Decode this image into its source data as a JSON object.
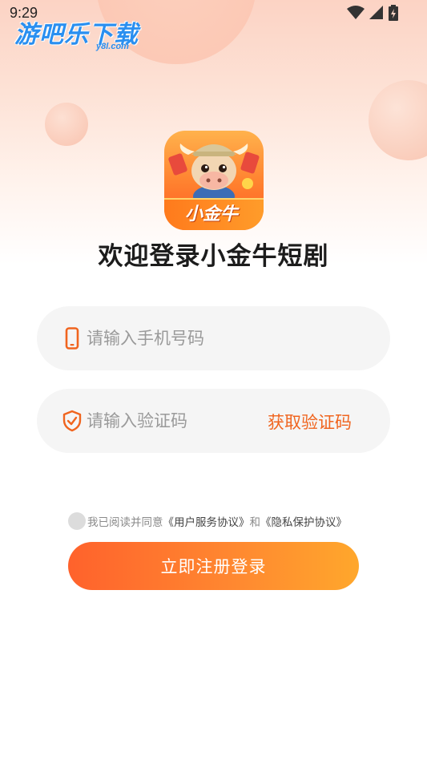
{
  "status_bar": {
    "time": "9:29"
  },
  "watermark": {
    "text": "游吧乐下载",
    "sub": "y8l.com"
  },
  "app": {
    "icon_banner": "小金牛",
    "welcome_title": "欢迎登录小金牛短剧"
  },
  "form": {
    "phone_placeholder": "请输入手机号码",
    "code_placeholder": "请输入验证码",
    "get_code_label": "获取验证码"
  },
  "agreement": {
    "prefix": "我已阅读并同意",
    "user_agreement": "《用户服务协议》",
    "and": "和",
    "privacy_policy": "《隐私保护协议》"
  },
  "submit_label": "立即注册登录",
  "colors": {
    "accent": "#f0641e",
    "button_start": "#ff622c",
    "button_end": "#ffa72c"
  }
}
